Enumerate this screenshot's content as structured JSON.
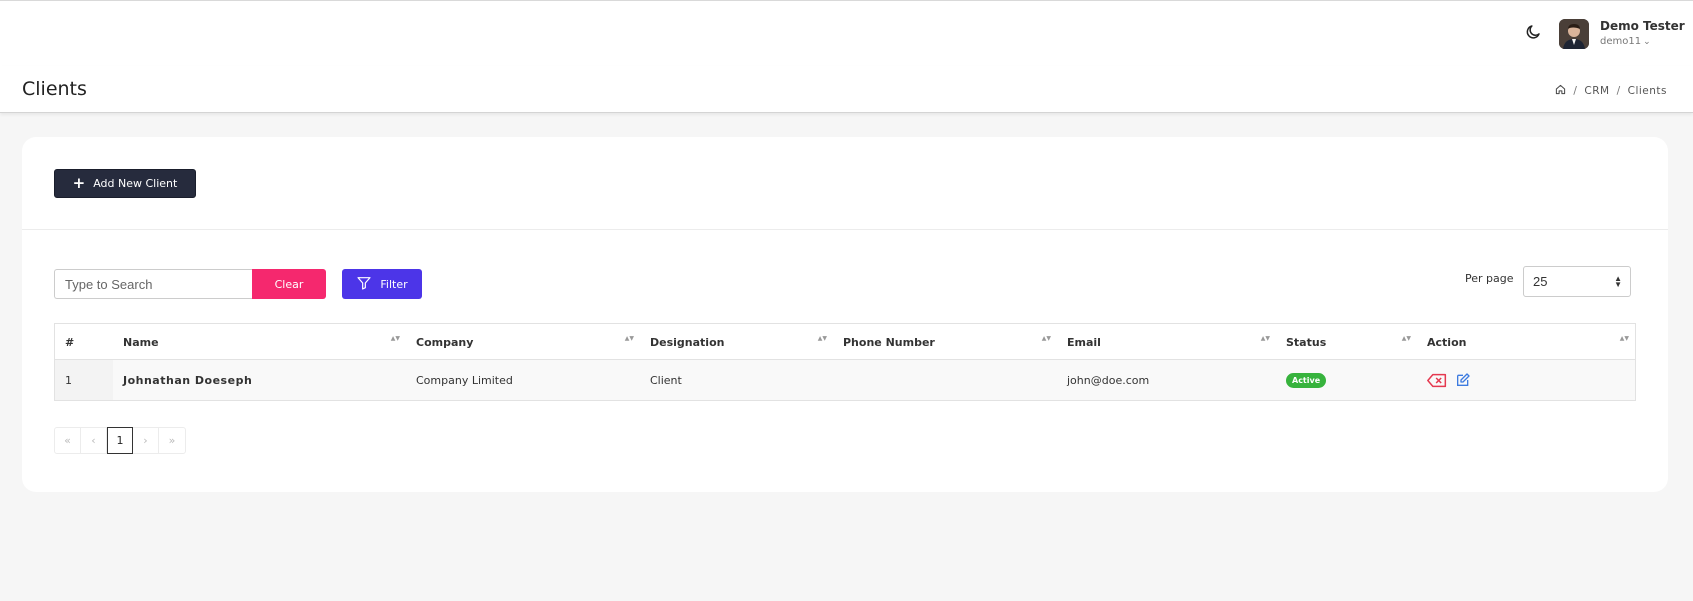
{
  "header": {
    "user_name": "Demo Tester",
    "user_handle": "demo11"
  },
  "page": {
    "title": "Clients",
    "breadcrumb": [
      "CRM",
      "Clients"
    ]
  },
  "toolbar": {
    "add_label": "Add New Client",
    "search_placeholder": "Type to Search",
    "clear_label": "Clear",
    "filter_label": "Filter",
    "per_page_label": "Per page",
    "per_page_value": "25"
  },
  "table": {
    "columns": [
      "#",
      "Name",
      "Company",
      "Designation",
      "Phone Number",
      "Email",
      "Status",
      "Action"
    ],
    "rows": [
      {
        "num": "1",
        "name": "Johnathan Doeseph",
        "company": "Company Limited",
        "designation": "Client",
        "phone": "",
        "email": "john@doe.com",
        "status": "Active"
      }
    ]
  },
  "pagination": {
    "first": "«",
    "prev": "‹",
    "current": "1",
    "next": "›",
    "last": "»"
  },
  "colors": {
    "primary_dark": "#262b3d",
    "clear": "#f5286e",
    "filter": "#4c35e8",
    "active_badge": "#37b33d",
    "delete_icon": "#e53950",
    "edit_icon": "#3d7be0"
  },
  "icons": {
    "theme": "moon-icon",
    "breadcrumb_home": "home-icon",
    "add": "plus-icon",
    "filter": "funnel-icon",
    "delete": "delete-icon",
    "edit": "edit-icon"
  }
}
